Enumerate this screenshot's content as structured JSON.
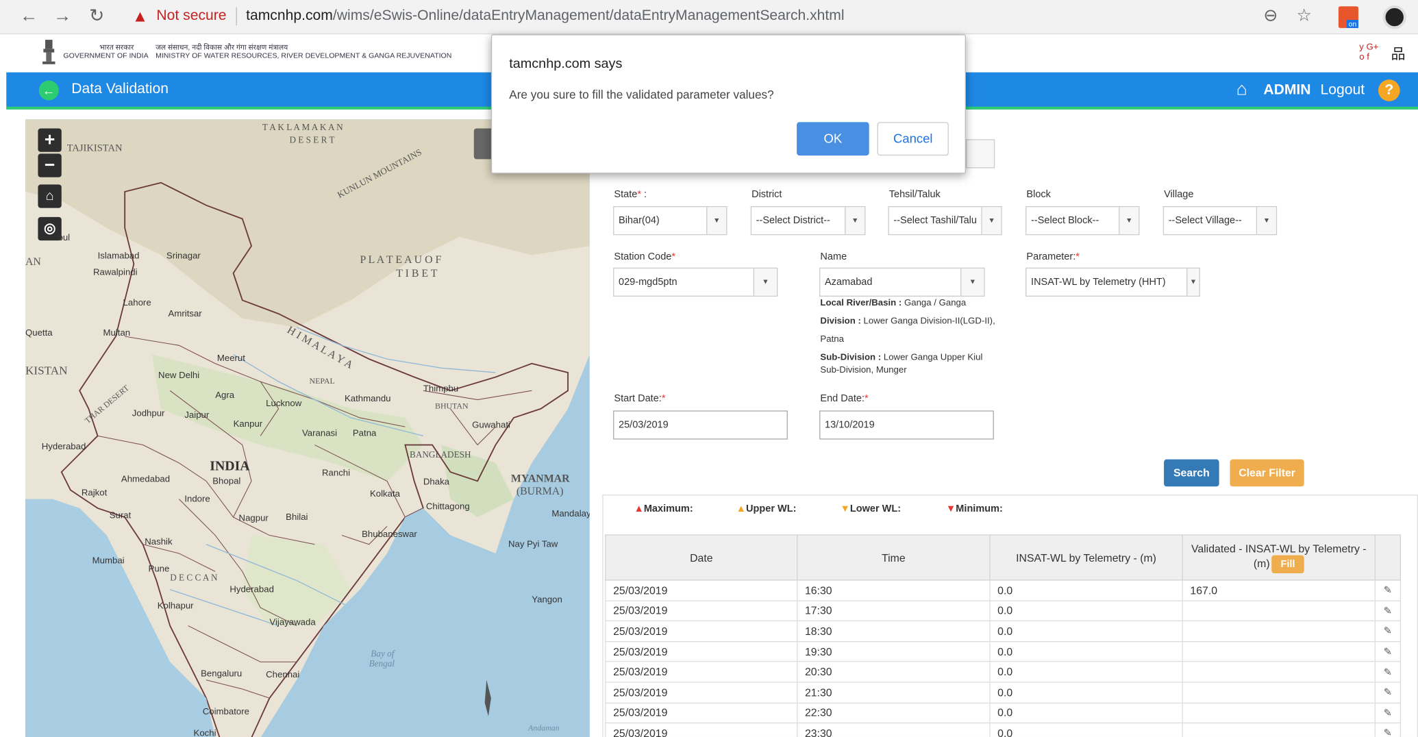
{
  "browser": {
    "security_text": "Not secure",
    "url_host": "tamcnhp.com",
    "url_path": "/wims/eSwis-Online/dataEntryManagement/dataEntryManagementSearch.xhtml"
  },
  "gov_header": {
    "line1_hindi": "भारत सरकार",
    "line1_en": "GOVERNMENT OF INDIA",
    "line2_hindi": "जल संसाधन, नदी विकास और गंगा संरक्षण मंत्रालय",
    "line2_en": "MINISTRY OF WATER RESOURCES, RIVER DEVELOPMENT & GANGA REJUVENATION"
  },
  "topbar": {
    "title": "Data Validation",
    "user": "ADMIN",
    "logout": "Logout",
    "help": "?"
  },
  "map": {
    "labels": {
      "takla1": "T A K L A   M A K A N",
      "takla2": "D E S E R T",
      "kunlun": "KUNLUN MOUNTAINS",
      "plateau1": "P L A T E A U   O F",
      "plateau2": "T I B E T",
      "himalaya": "H I M A L A Y A",
      "tajikistan": "TAJIKISTAN",
      "pakistan": "KISTAN",
      "an": "AN",
      "india": "INDIA",
      "nepal": "NEPAL",
      "bhutan": "BHUTAN",
      "bangladesh": "BANGLADESH",
      "myanmar1": "MYANMAR",
      "myanmar2": "(BURMA)",
      "deccan": "D E C C A N",
      "thar": "THAR DESERT",
      "bay1": "Bay of",
      "bay2": "Bengal",
      "andaman": "Andaman"
    },
    "cities": [
      "Islamabad",
      "Srinagar",
      "Rawalpindi",
      "Lahore",
      "Amritsar",
      "Quetta",
      "Multan",
      "Meerut",
      "New Delhi",
      "Agra",
      "Lucknow",
      "Kathmandu",
      "Thimphu",
      "Jodhpur",
      "Jaipur",
      "Kanpur",
      "Varanasi",
      "Patna",
      "Guwahati",
      "Hyderabad",
      "Ahmedabad",
      "Bhopal",
      "Ranchi",
      "Kolkata",
      "Dhaka",
      "Rajkot",
      "Indore",
      "Surat",
      "Nagpur",
      "Bhilai",
      "Chittagong",
      "Mandalay",
      "Bhubaneswar",
      "Nashik",
      "Mumbai",
      "Pune",
      "Nay Pyi Taw",
      "Hyderabad",
      "Kolhapur",
      "Yangon",
      "Vijayawada",
      "Bengaluru",
      "Chennai",
      "Coimbatore",
      "Kochi",
      "bul"
    ]
  },
  "form": {
    "state_label": "State",
    "state_value": "Bihar(04)",
    "district_label": "District",
    "district_value": "--Select District--",
    "tehsil_label": "Tehsil/Taluk",
    "tehsil_value": "--Select Tashil/Talu",
    "block_label": "Block",
    "block_value": "--Select Block--",
    "village_label": "Village",
    "village_value": "--Select Village--",
    "station_label": "Station Code",
    "station_value": "029-mgd5ptn",
    "name_label": "Name",
    "name_value": "Azamabad",
    "parameter_label": "Parameter:",
    "parameter_value": "INSAT-WL by Telemetry (HHT)",
    "river_label": "Local River/Basin :",
    "river_value": "Ganga / Ganga",
    "division_label": "Division :",
    "division_value": "Lower Ganga Division-II(LGD-II), Patna",
    "subdivision_label": "Sub-Division :",
    "subdivision_value": "Lower Ganga Upper Kiul Sub-Division, Munger",
    "start_label": "Start Date:",
    "start_value": "25/03/2019",
    "end_label": "End Date:",
    "end_value": "13/10/2019",
    "search": "Search",
    "clear": "Clear Filter"
  },
  "legend": {
    "max": "Maximum:",
    "upper": "Upper WL:",
    "lower": "Lower WL:",
    "min": "Minimum:",
    "max_color": "#e53935",
    "upper_color": "#f5a623",
    "lower_color": "#f5a623",
    "min_color": "#e53935"
  },
  "table": {
    "headers": {
      "date": "Date",
      "time": "Time",
      "insat": "INSAT-WL by Telemetry - (m)",
      "validated": "Validated - INSAT-WL by Telemetry - (m)",
      "fill": "Fill"
    },
    "rows": [
      {
        "date": "25/03/2019",
        "time": "16:30",
        "value": "0.0",
        "validated": "167.0"
      },
      {
        "date": "25/03/2019",
        "time": "17:30",
        "value": "0.0",
        "validated": ""
      },
      {
        "date": "25/03/2019",
        "time": "18:30",
        "value": "0.0",
        "validated": ""
      },
      {
        "date": "25/03/2019",
        "time": "19:30",
        "value": "0.0",
        "validated": ""
      },
      {
        "date": "25/03/2019",
        "time": "20:30",
        "value": "0.0",
        "validated": ""
      },
      {
        "date": "25/03/2019",
        "time": "21:30",
        "value": "0.0",
        "validated": ""
      },
      {
        "date": "25/03/2019",
        "time": "22:30",
        "value": "0.0",
        "validated": ""
      },
      {
        "date": "25/03/2019",
        "time": "23:30",
        "value": "0.0",
        "validated": ""
      }
    ]
  },
  "dialog": {
    "title": "tamcnhp.com says",
    "message": "Are you sure to fill the validated parameter values?",
    "ok": "OK",
    "cancel": "Cancel"
  }
}
